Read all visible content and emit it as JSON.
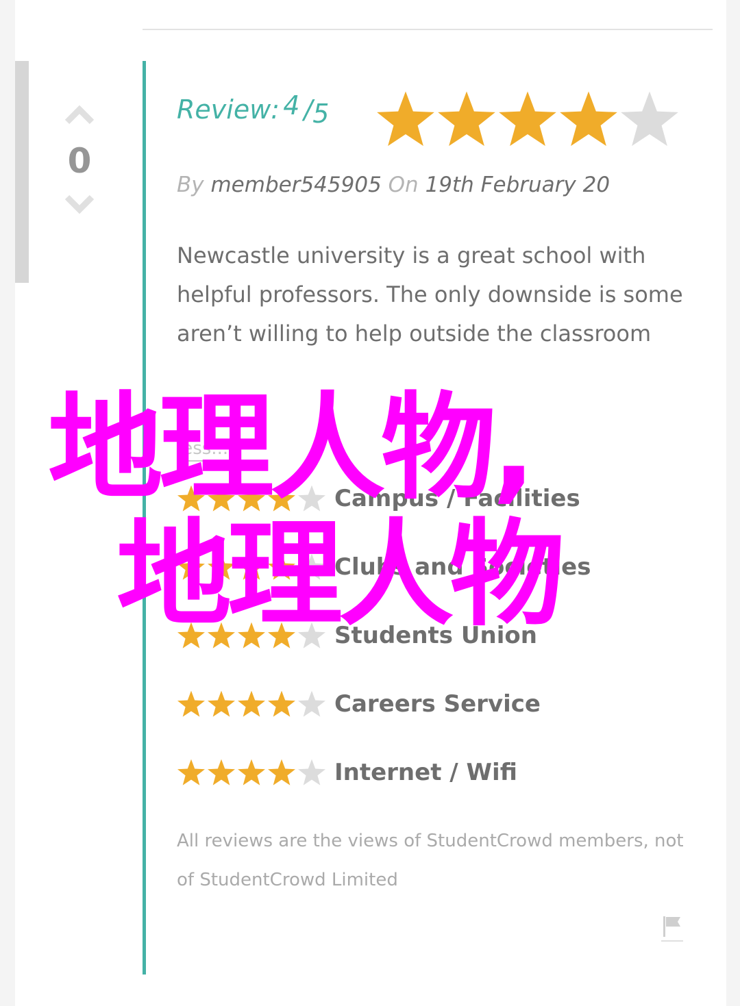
{
  "review": {
    "label": "Review:",
    "score": "4",
    "score_slash": "/",
    "score_max": "5",
    "rating": 4,
    "max_rating": 5,
    "by_label": "By",
    "author": "member545905",
    "on_label": "On",
    "date": "19th February 20",
    "body": "Newcastle university is a great school with helpful professors. The only downside is some aren’t willing to help outside the classroom",
    "less_link": "less..."
  },
  "votes": {
    "count": "0",
    "upvote_icon": "chevron-up-icon",
    "downvote_icon": "chevron-down-icon"
  },
  "categories": [
    {
      "label": "Campus / Facilities",
      "rating": 4
    },
    {
      "label": "Clubs and Societies",
      "rating": 4
    },
    {
      "label": "Students Union",
      "rating": 4
    },
    {
      "label": "Careers Service",
      "rating": 4
    },
    {
      "label": "Internet / Wifi",
      "rating": 4
    }
  ],
  "disclaimer": "All reviews are the views of StudentCrowd members, not of StudentCrowd Limited",
  "flag": {
    "icon": "flag-icon"
  },
  "watermark": {
    "line1": "地理人物,",
    "line2": "地理人物"
  },
  "colors": {
    "accent": "#44b2a6",
    "star_filled": "#f0ac2a",
    "star_empty": "#dcdcdc",
    "watermark": "#ff00ff"
  }
}
